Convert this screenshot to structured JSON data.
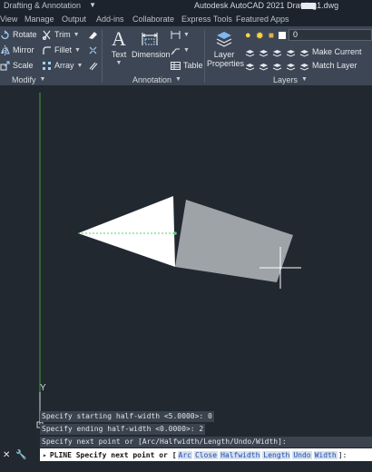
{
  "titlebar": {
    "workspace": "Drafting & Annotation",
    "app_title": "Autodesk AutoCAD 2021    Drawing1.dwg"
  },
  "menu_tabs": [
    "View",
    "Manage",
    "Output",
    "Add-ins",
    "Collaborate",
    "Express Tools",
    "Featured Apps"
  ],
  "ribbon": {
    "modify": {
      "rotate": "Rotate",
      "trim": "Trim",
      "mirror": "Mirror",
      "fillet": "Fillet",
      "scale": "Scale",
      "array": "Array",
      "panel_label": "Modify"
    },
    "annotation": {
      "text": "Text",
      "dimension": "Dimension",
      "table": "Table",
      "panel_label": "Annotation"
    },
    "layers": {
      "layer_properties_line1": "Layer",
      "layer_properties_line2": "Properties",
      "current_layer": "0",
      "make_current": "Make Current",
      "match_layer": "Match Layer",
      "panel_label": "Layers"
    }
  },
  "canvas": {
    "background": "#212830",
    "ucs_y_label": "Y",
    "triangle_color": "#ffffff",
    "rect_color": "#9ea3a8"
  },
  "history": {
    "line1": "Specify starting half-width <5.0000>: 0",
    "line2": "Specify ending half-width <0.0000>: 2",
    "line3": "Specify next point or [Arc/Halfwidth/Length/Undo/Width]:"
  },
  "command_line": {
    "prefix": "PLINE Specify next point or [",
    "options": [
      "Arc",
      "Close",
      "Halfwidth",
      "Length",
      "Undo",
      "Width"
    ],
    "suffix": "]:"
  }
}
